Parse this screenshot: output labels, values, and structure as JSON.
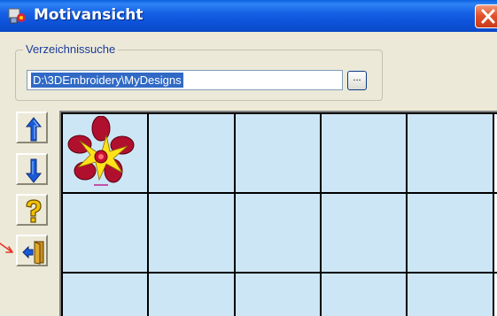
{
  "window": {
    "title": "Motivansicht",
    "title_icon": "embroidery-app-icon",
    "close_icon": "close-icon"
  },
  "directory_search": {
    "label": "Verzeichnissuche",
    "path_value": "D:\\3DEmbroidery\\MyDesigns",
    "browse_label": "..."
  },
  "toolbar": {
    "buttons": [
      {
        "name": "scroll-up",
        "icon": "arrow-up-icon"
      },
      {
        "name": "scroll-down",
        "icon": "arrow-down-icon"
      },
      {
        "name": "help",
        "icon": "question-mark-icon"
      },
      {
        "name": "exit",
        "icon": "exit-door-icon"
      }
    ]
  },
  "design_grid": {
    "columns": 5,
    "visible_rows": 3,
    "items": [
      {
        "name": "flower-design-thumbnail",
        "icon": "red-flower-icon"
      }
    ]
  },
  "colors": {
    "titlebar": "#0a55d8",
    "cell_background": "#cde6f5",
    "selection": "#316ac5",
    "flower_petal": "#b0102e",
    "flower_center": "#ffe21a"
  }
}
